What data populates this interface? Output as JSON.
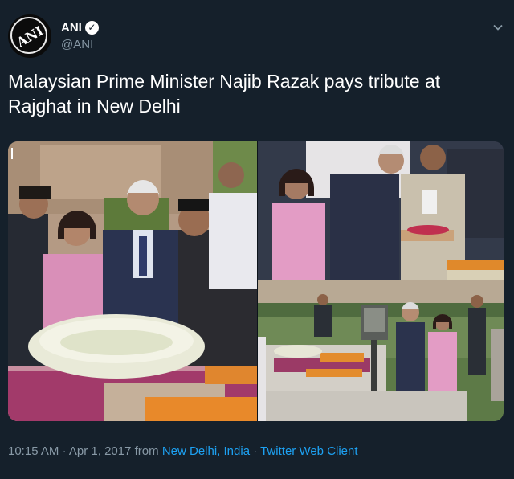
{
  "account": {
    "display_name": "ANI",
    "handle": "@ANI",
    "avatar_text": "ANI",
    "verified": true
  },
  "tweet": {
    "text": "Malaysian Prime Minister Najib Razak pays tribute at Rajghat in New Delhi"
  },
  "media": {
    "photos": [
      {
        "description": "wreath-laying-front"
      },
      {
        "description": "flower-offering"
      },
      {
        "description": "memorial-walk"
      }
    ]
  },
  "meta": {
    "time": "10:15 AM",
    "separator": "·",
    "date": "Apr 1, 2017",
    "from_label": "from",
    "location": "New Delhi, India",
    "source": "Twitter Web Client"
  },
  "colors": {
    "background": "#15202b",
    "secondary_text": "#8899a6",
    "link": "#1da1f2"
  },
  "icons": {
    "verified": "verified-badge-icon",
    "caret": "chevron-down-icon"
  }
}
